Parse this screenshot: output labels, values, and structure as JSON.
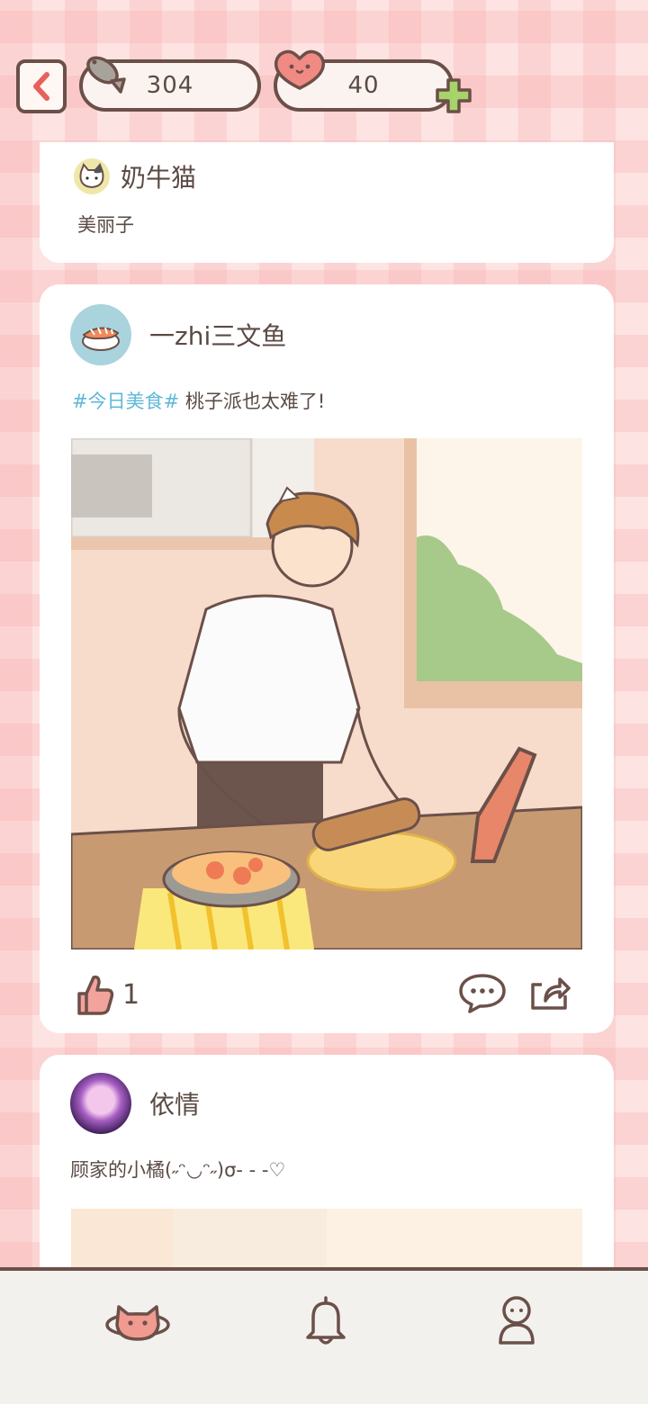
{
  "header": {
    "back_icon": "chevron-left-icon",
    "fish_icon": "fish-icon",
    "fish_count": "304",
    "heart_icon": "heart-face-icon",
    "heart_count": "40",
    "plus_icon": "plus-icon"
  },
  "posts": [
    {
      "username": "奶牛猫",
      "text": "美丽子"
    },
    {
      "username": "一zhi三文鱼",
      "hashtag": "#今日美食#",
      "text": " 桃子派也太难了!",
      "likes": "1"
    },
    {
      "username": "依情",
      "text": "顾家的小橘(˶ᵔ◡ᵔ˶)σ- - -♡"
    }
  ],
  "nav": {
    "items": [
      "home-planet-icon",
      "bell-icon",
      "profile-icon"
    ]
  },
  "colors": {
    "background": "#fde3e2",
    "outline": "#6b5049",
    "accent_red": "#e8756e",
    "accent_green": "#a7d46a",
    "hashtag": "#5fb8d8"
  }
}
